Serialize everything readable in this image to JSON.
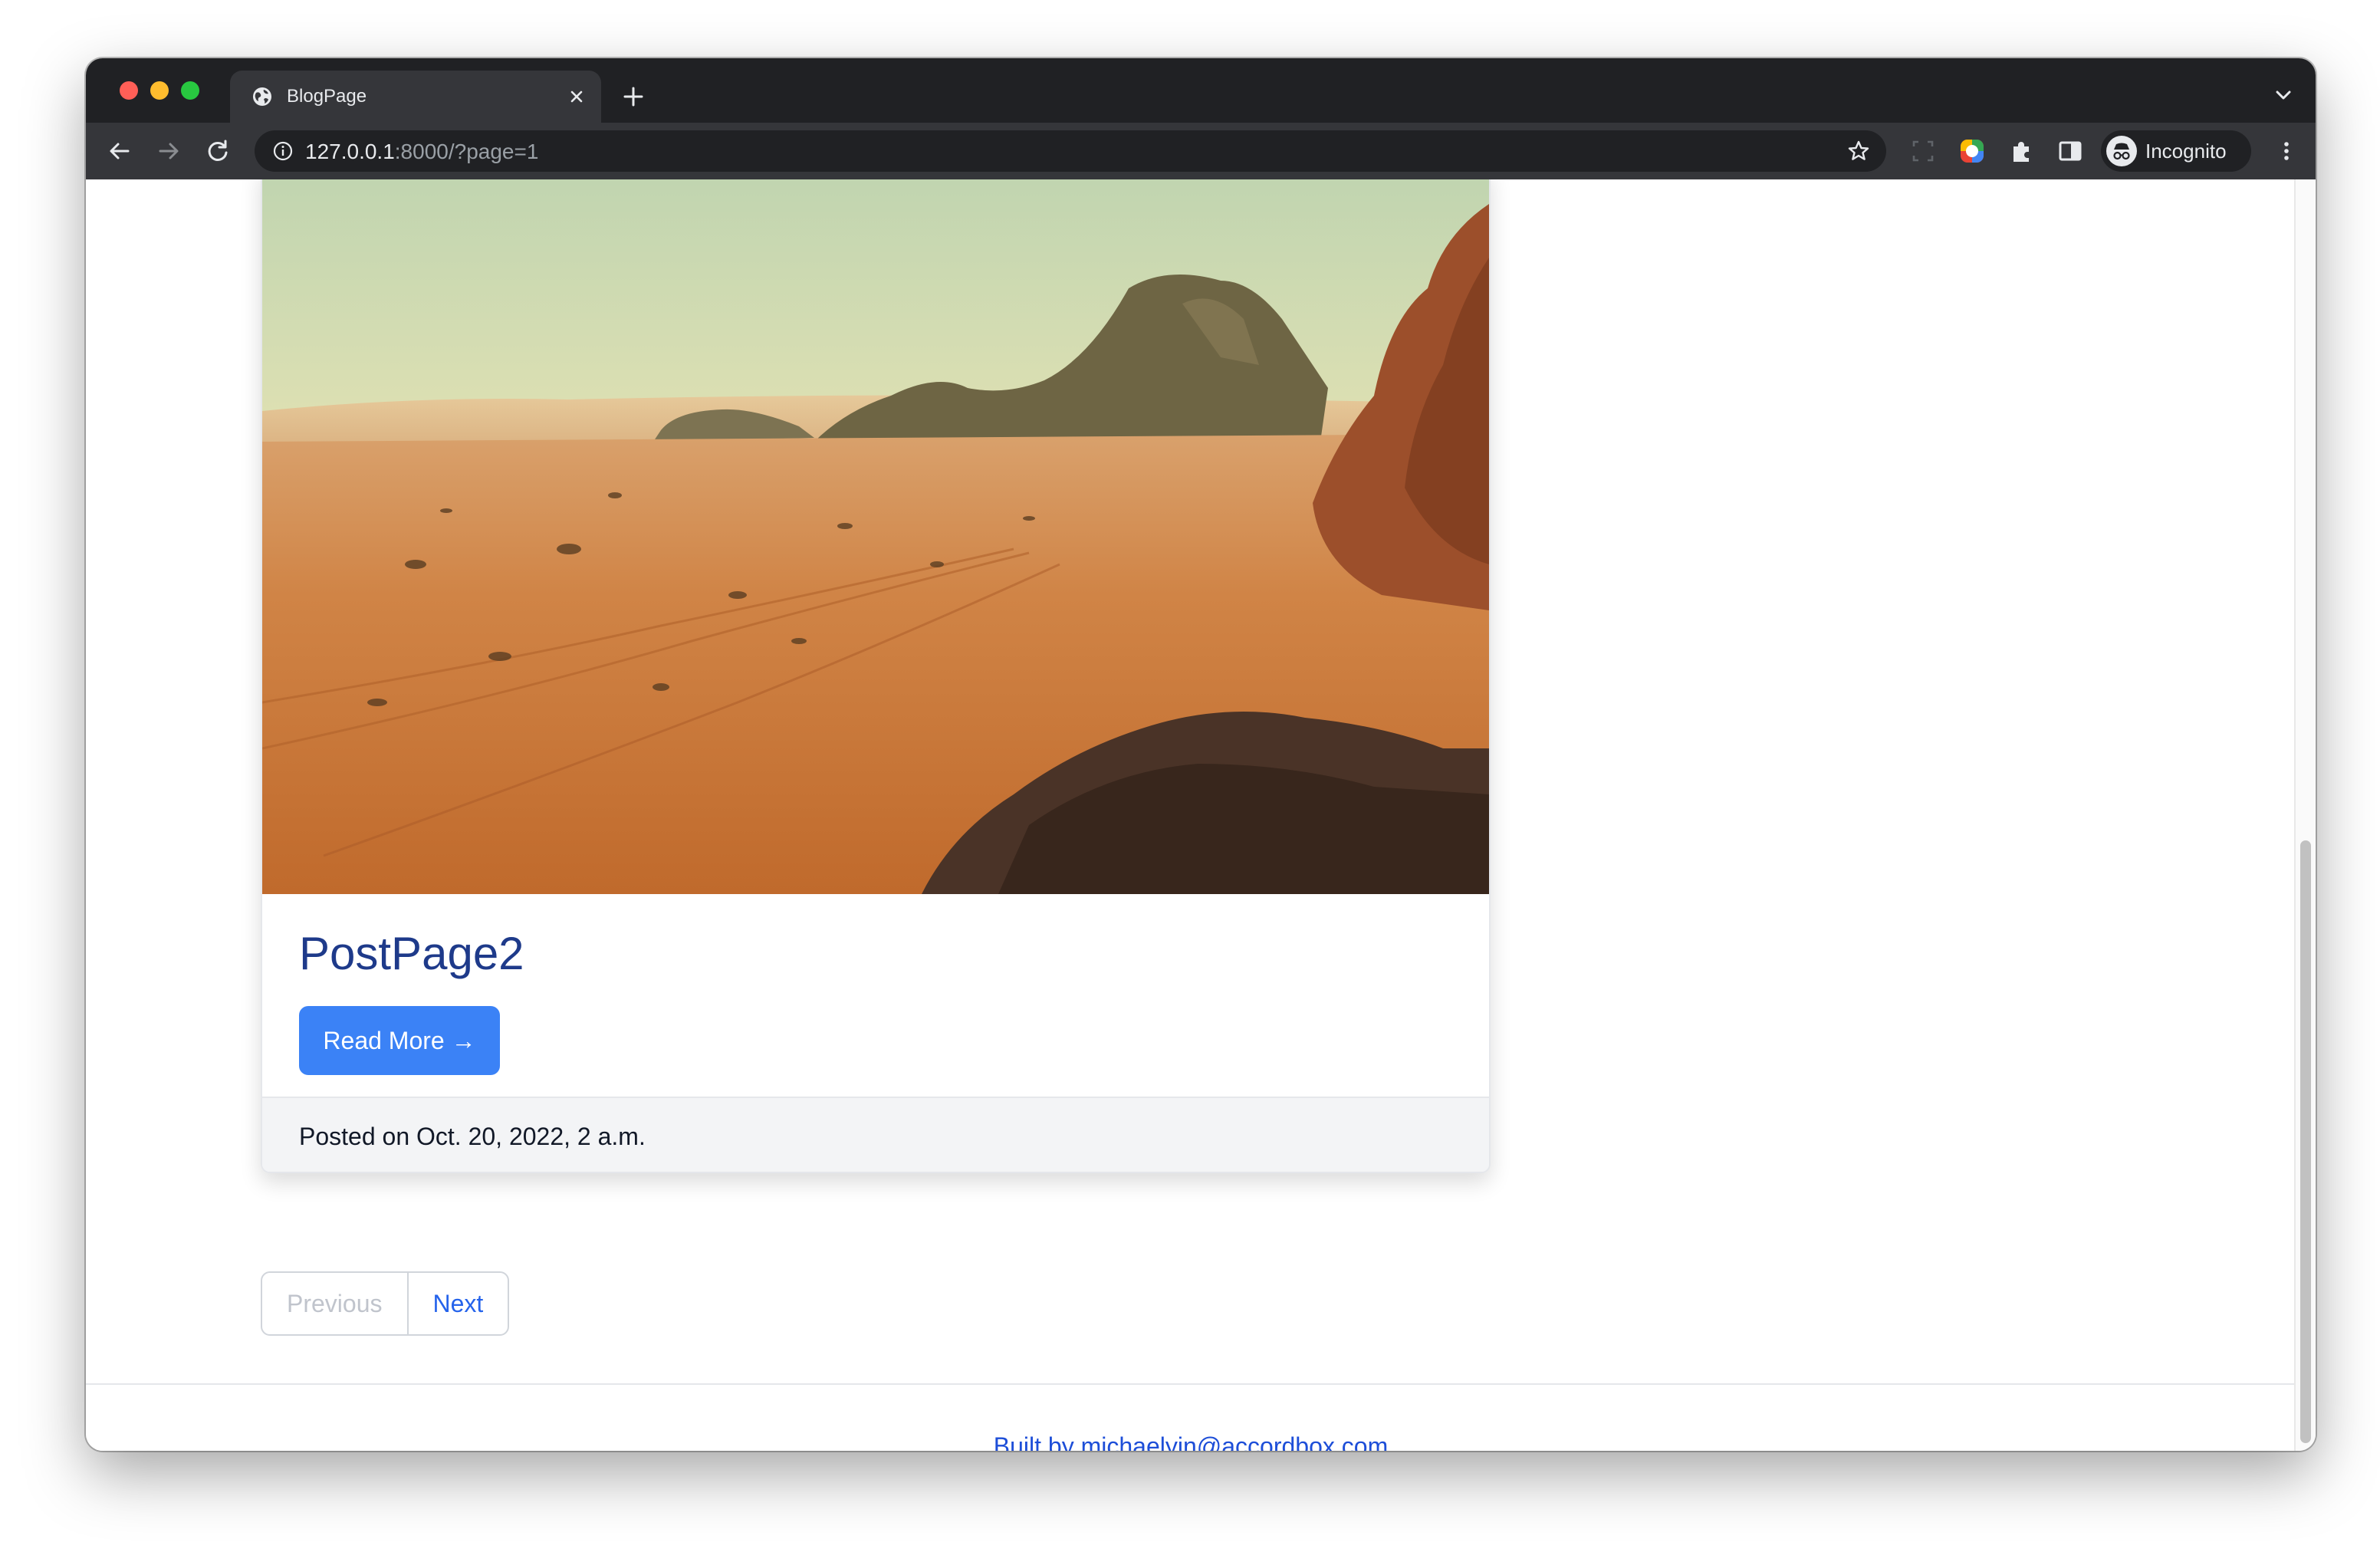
{
  "browser": {
    "tab_title": "BlogPage",
    "url_host": "127.0.0.1",
    "url_rest": ":8000/?page=1",
    "profile_label": "Incognito"
  },
  "post": {
    "title": "PostPage2",
    "read_more_label": "Read More →",
    "posted_on": "Posted on Oct. 20, 2022, 2 a.m.",
    "image_description": "desert-landscape"
  },
  "pagination": {
    "previous_label": "Previous",
    "next_label": "Next",
    "previous_disabled": true
  },
  "footer": {
    "text": "Built by michaelyin@accordbox.com"
  },
  "colors": {
    "chrome_dark": "#202124",
    "chrome_tab": "#35363a",
    "title_color": "#1e3a8a",
    "button_blue": "#3b82f6",
    "link_blue": "#2563eb",
    "footer_link": "#1d4ed8",
    "card_footer_bg": "#f3f4f6"
  },
  "icons": {
    "tab_favicon": "globe-icon",
    "tab_close": "close-icon",
    "new_tab": "plus-icon",
    "back": "arrow-left-icon",
    "forward": "arrow-right-icon",
    "reload": "reload-icon",
    "site_info": "info-icon",
    "bookmark": "star-icon",
    "extensions": "puzzle-icon",
    "side_panel": "side-panel-icon",
    "menu": "kebab-menu-icon"
  }
}
